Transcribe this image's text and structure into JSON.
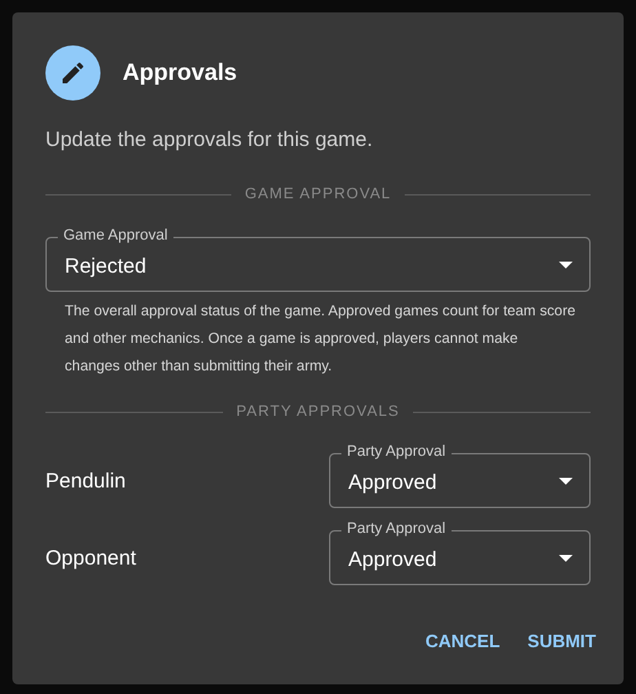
{
  "dialog": {
    "title": "Approvals",
    "description": "Update the approvals for this game."
  },
  "sections": [
    {
      "heading": "GAME APPROVAL",
      "select": {
        "label": "Game Approval",
        "value": "Rejected"
      },
      "helper": "The overall approval status of the game. Approved games count for team score and other mechanics. Once a game is approved, players cannot make changes other than submitting their army."
    },
    {
      "heading": "PARTY APPROVALS",
      "rows": [
        {
          "name": "Pendulin",
          "select": {
            "label": "Party Approval",
            "value": "Approved"
          }
        },
        {
          "name": "Opponent",
          "select": {
            "label": "Party Approval",
            "value": "Approved"
          }
        }
      ]
    }
  ],
  "buttons": [
    "CANCEL",
    "SUBMIT"
  ]
}
